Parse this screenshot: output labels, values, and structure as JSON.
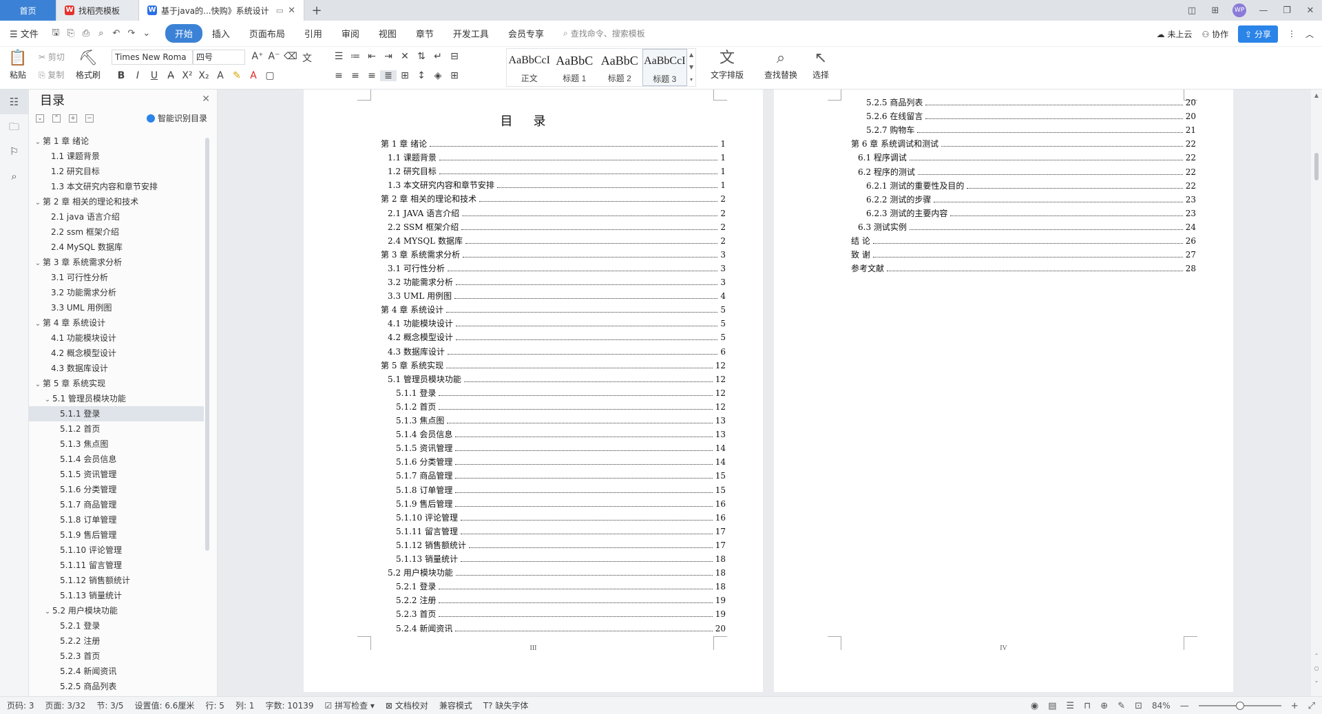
{
  "tabs": [
    {
      "label": "首页"
    },
    {
      "label": "找稻壳模板"
    },
    {
      "label": "基于java的...快购》系统设计"
    }
  ],
  "menubar": {
    "file": "文件",
    "items": [
      "开始",
      "插入",
      "页面布局",
      "引用",
      "审阅",
      "视图",
      "章节",
      "开发工具",
      "会员专享"
    ],
    "search_placeholder": "查找命令、搜索模板",
    "cloud": "未上云",
    "collab": "协作",
    "share": "分享"
  },
  "ribbon": {
    "paste": "粘贴",
    "cut": "剪切",
    "copy": "复制",
    "format_painter": "格式刷",
    "font_name": "Times New Roma",
    "font_size": "四号",
    "styles": [
      {
        "preview": "AaBbCcI",
        "name": "正文"
      },
      {
        "preview": "AaBbC",
        "name": "标题 1"
      },
      {
        "preview": "AaBbC",
        "name": "标题 2"
      },
      {
        "preview": "AaBbCcI",
        "name": "标题 3"
      }
    ],
    "text_layout": "文字排版",
    "find_replace": "查找替换",
    "select": "选择"
  },
  "nav": {
    "title": "目录",
    "smart": "智能识别目录",
    "items": [
      {
        "label": "第 1 章   绪论",
        "level": 1,
        "arrow": "v"
      },
      {
        "label": "1.1 课题背景",
        "level": 2
      },
      {
        "label": "1.2 研究目标",
        "level": 2
      },
      {
        "label": "1.3 本文研究内容和章节安排",
        "level": 2
      },
      {
        "label": "第 2 章   相关的理论和技术",
        "level": 1,
        "arrow": "v"
      },
      {
        "label": "2.1 java 语言介绍",
        "level": 2
      },
      {
        "label": "2.2 ssm 框架介绍",
        "level": 2
      },
      {
        "label": "2.4 MySQL 数据库",
        "level": 2
      },
      {
        "label": "第 3 章   系统需求分析",
        "level": 1,
        "arrow": "v"
      },
      {
        "label": "3.1 可行性分析",
        "level": 2
      },
      {
        "label": "3.2 功能需求分析",
        "level": 2
      },
      {
        "label": "3.3 UML 用例图",
        "level": 2
      },
      {
        "label": "第 4 章   系统设计",
        "level": 1,
        "arrow": "v"
      },
      {
        "label": "4.1 功能模块设计",
        "level": 2
      },
      {
        "label": "4.2 概念模型设计",
        "level": 2
      },
      {
        "label": "4.3 数据库设计",
        "level": 2
      },
      {
        "label": "第 5 章   系统实现",
        "level": 1,
        "arrow": "v"
      },
      {
        "label": "5.1 管理员模块功能",
        "level": 2,
        "arrow": "v"
      },
      {
        "label": "5.1.1 登录",
        "level": 3,
        "selected": true
      },
      {
        "label": "5.1.2 首页",
        "level": 3
      },
      {
        "label": "5.1.3 焦点图",
        "level": 3
      },
      {
        "label": "5.1.4 会员信息",
        "level": 3
      },
      {
        "label": "5.1.5 资讯管理",
        "level": 3
      },
      {
        "label": "5.1.6 分类管理",
        "level": 3
      },
      {
        "label": "5.1.7 商品管理",
        "level": 3
      },
      {
        "label": "5.1.8 订单管理",
        "level": 3
      },
      {
        "label": "5.1.9 售后管理",
        "level": 3
      },
      {
        "label": "5.1.10 评论管理",
        "level": 3
      },
      {
        "label": "5.1.11 留言管理",
        "level": 3
      },
      {
        "label": "5.1.12 销售额统计",
        "level": 3
      },
      {
        "label": "5.1.13 销量统计",
        "level": 3
      },
      {
        "label": "5.2 用户模块功能",
        "level": 2,
        "arrow": "v"
      },
      {
        "label": "5.2.1 登录",
        "level": 3
      },
      {
        "label": "5.2.2 注册",
        "level": 3
      },
      {
        "label": "5.2.3 首页",
        "level": 3
      },
      {
        "label": "5.2.4 新闻资讯",
        "level": 3
      },
      {
        "label": "5.2.5 商品列表",
        "level": 3
      }
    ]
  },
  "page1": {
    "title": "目录",
    "page_label": "III",
    "rows": [
      {
        "text": "第 1 章   绪论",
        "page": "1",
        "level": 1
      },
      {
        "text": "1.1 课题背景",
        "page": "1",
        "level": 2
      },
      {
        "text": "1.2 研究目标",
        "page": "1",
        "level": 2
      },
      {
        "text": "1.3 本文研究内容和章节安排",
        "page": "1",
        "level": 2
      },
      {
        "text": "第 2 章   相关的理论和技术",
        "page": "2",
        "level": 1
      },
      {
        "text": "2.1 JAVA 语言介绍",
        "page": "2",
        "level": 2
      },
      {
        "text": "2.2 SSM 框架介绍",
        "page": "2",
        "level": 2
      },
      {
        "text": "2.4 MYSQL 数据库",
        "page": "2",
        "level": 2
      },
      {
        "text": "第 3 章   系统需求分析",
        "page": "3",
        "level": 1
      },
      {
        "text": "3.1 可行性分析",
        "page": "3",
        "level": 2
      },
      {
        "text": "3.2 功能需求分析",
        "page": "3",
        "level": 2
      },
      {
        "text": "3.3 UML 用例图",
        "page": "4",
        "level": 2
      },
      {
        "text": "第 4 章   系统设计",
        "page": "5",
        "level": 1
      },
      {
        "text": "4.1 功能模块设计",
        "page": "5",
        "level": 2
      },
      {
        "text": "4.2 概念模型设计",
        "page": "5",
        "level": 2
      },
      {
        "text": "4.3 数据库设计",
        "page": "6",
        "level": 2
      },
      {
        "text": "第 5 章   系统实现",
        "page": "12",
        "level": 1
      },
      {
        "text": "5.1 管理员模块功能",
        "page": "12",
        "level": 2
      },
      {
        "text": "5.1.1 登录",
        "page": "12",
        "level": 3
      },
      {
        "text": "5.1.2 首页",
        "page": "12",
        "level": 3
      },
      {
        "text": "5.1.3 焦点图",
        "page": "13",
        "level": 3
      },
      {
        "text": "5.1.4 会员信息",
        "page": "13",
        "level": 3
      },
      {
        "text": "5.1.5 资讯管理",
        "page": "14",
        "level": 3
      },
      {
        "text": "5.1.6 分类管理",
        "page": "14",
        "level": 3
      },
      {
        "text": "5.1.7 商品管理",
        "page": "15",
        "level": 3
      },
      {
        "text": "5.1.8 订单管理",
        "page": "15",
        "level": 3
      },
      {
        "text": "5.1.9 售后管理",
        "page": "16",
        "level": 3
      },
      {
        "text": "5.1.10 评论管理",
        "page": "16",
        "level": 3
      },
      {
        "text": "5.1.11 留言管理",
        "page": "17",
        "level": 3
      },
      {
        "text": "5.1.12 销售额统计",
        "page": "17",
        "level": 3
      },
      {
        "text": "5.1.13 销量统计",
        "page": "18",
        "level": 3
      },
      {
        "text": "5.2 用户模块功能",
        "page": "18",
        "level": 2
      },
      {
        "text": "5.2.1 登录",
        "page": "18",
        "level": 3
      },
      {
        "text": "5.2.2 注册",
        "page": "19",
        "level": 3
      },
      {
        "text": "5.2.3 首页",
        "page": "19",
        "level": 3
      },
      {
        "text": "5.2.4 新闻资讯",
        "page": "20",
        "level": 3
      }
    ]
  },
  "page2": {
    "page_label": "IV",
    "rows": [
      {
        "text": "5.2.5 商品列表",
        "page": "20",
        "level": 3
      },
      {
        "text": "5.2.6 在线留言",
        "page": "20",
        "level": 3
      },
      {
        "text": "5.2.7 购物车",
        "page": "21",
        "level": 3
      },
      {
        "text": "第 6 章   系统调试和测试",
        "page": "22",
        "level": 1
      },
      {
        "text": "6.1 程序调试",
        "page": "22",
        "level": 2
      },
      {
        "text": "6.2 程序的测试",
        "page": "22",
        "level": 2
      },
      {
        "text": "6.2.1 测试的重要性及目的",
        "page": "22",
        "level": 3
      },
      {
        "text": "6.2.2 测试的步骤",
        "page": "23",
        "level": 3
      },
      {
        "text": "6.2.3 测试的主要内容",
        "page": "23",
        "level": 3
      },
      {
        "text": "6.3 测试实例",
        "page": "24",
        "level": 2
      },
      {
        "text": "结      论",
        "page": "26",
        "level": 1
      },
      {
        "text": "致      谢",
        "page": "27",
        "level": 1
      },
      {
        "text": "参考文献",
        "page": "28",
        "level": 1
      }
    ]
  },
  "status": {
    "page_code": "页码: 3",
    "page": "页面: 3/32",
    "section": "节: 3/5",
    "setting": "设置值: 6.6厘米",
    "row": "行: 5",
    "col": "列: 1",
    "words": "字数: 10139",
    "spell": "拼写检查",
    "proof": "文档校对",
    "compat": "兼容模式",
    "missing_font": "缺失字体",
    "zoom": "84%"
  }
}
